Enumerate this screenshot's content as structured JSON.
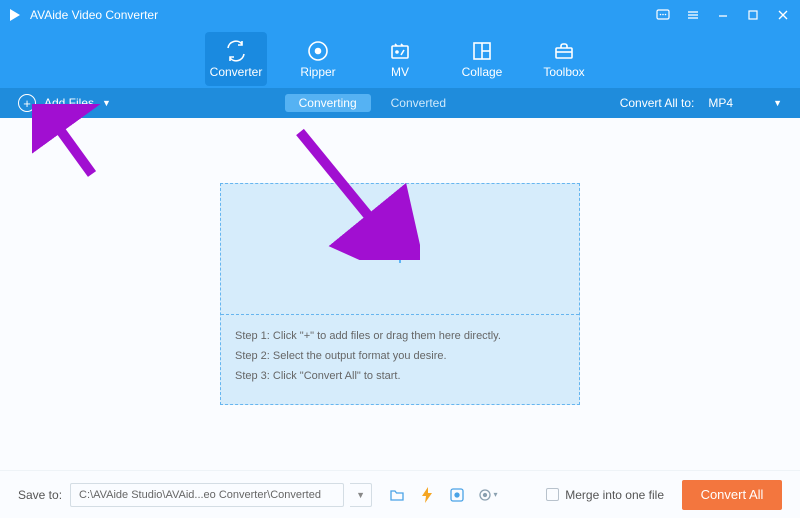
{
  "titlebar": {
    "title": "AVAide Video Converter"
  },
  "nav": {
    "items": [
      {
        "label": "Converter"
      },
      {
        "label": "Ripper"
      },
      {
        "label": "MV"
      },
      {
        "label": "Collage"
      },
      {
        "label": "Toolbox"
      }
    ]
  },
  "subbar": {
    "add_files_label": "Add Files",
    "converting_label": "Converting",
    "converted_label": "Converted",
    "convert_all_to_label": "Convert All to:",
    "format": "MP4"
  },
  "steps": {
    "s1": "Step 1: Click \"+\" to add files or drag them here directly.",
    "s2": "Step 2: Select the output format you desire.",
    "s3": "Step 3: Click \"Convert All\" to start."
  },
  "footer": {
    "save_to_label": "Save to:",
    "path": "C:\\AVAide Studio\\AVAid...eo Converter\\Converted",
    "merge_label": "Merge into one file",
    "convert_all_label": "Convert All"
  },
  "colors": {
    "primary": "#2a9df4",
    "accent": "#f3763e",
    "annotation": "#a10fd1"
  }
}
